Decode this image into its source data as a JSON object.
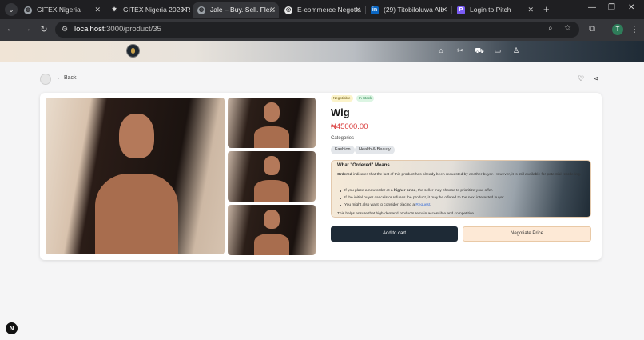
{
  "browser": {
    "tabs": [
      {
        "title": "GITEX Nigeria",
        "icon": "globe-icon"
      },
      {
        "title": "GITEX Nigeria 2025 R",
        "icon": "gitex-icon"
      },
      {
        "title": "Jale – Buy. Sell. Flex.",
        "icon": "globe-icon",
        "active": true
      },
      {
        "title": "E-commerce Negotia",
        "icon": "chatgpt-icon"
      },
      {
        "title": "(29) Titobiloluwa Alb",
        "icon": "linkedin-icon"
      },
      {
        "title": "Login to Pitch",
        "icon": "pitch-icon"
      }
    ],
    "url_host": "localhost",
    "url_path": ":3000/product/35",
    "profile_initial": "T"
  },
  "site": {
    "nav_icons": [
      "home-icon",
      "tools-icon",
      "cart-icon",
      "messages-icon",
      "user-icon"
    ]
  },
  "page": {
    "back_label": "Back",
    "badges": {
      "negotiable": "Negotiable",
      "stock": "In Stock"
    },
    "title": "Wig",
    "price": "₦45000.00",
    "categories_label": "Categories",
    "categories": [
      "Fashion",
      "Health & Beauty"
    ],
    "info": {
      "heading": "What \"Ordered\" Means",
      "intro_bold": "Ordered",
      "intro_rest": " indicates that the last of this product has already been requested by another buyer. However, it is still available for potential reordering.",
      "bullet1_pre": "If you place a new order at a ",
      "bullet1_bold": "higher price",
      "bullet1_post": ", the seller may choose to prioritize your offer.",
      "bullet2": "If the initial buyer cancels or refuses the product, it may be offered to the next interested buyer.",
      "bullet3_pre": "You might also want to consider placing a ",
      "bullet3_link": "Request",
      "bullet3_post": ".",
      "footer": "This helps ensure that high-demand products remain accessible and competitive."
    },
    "add_to_cart": "Add to cart",
    "negotiate": "Negotiate Price"
  },
  "colors": {
    "price": "#d93a3a",
    "cart_button": "#1e2a36",
    "negotiate_button": "#fde9d6"
  }
}
